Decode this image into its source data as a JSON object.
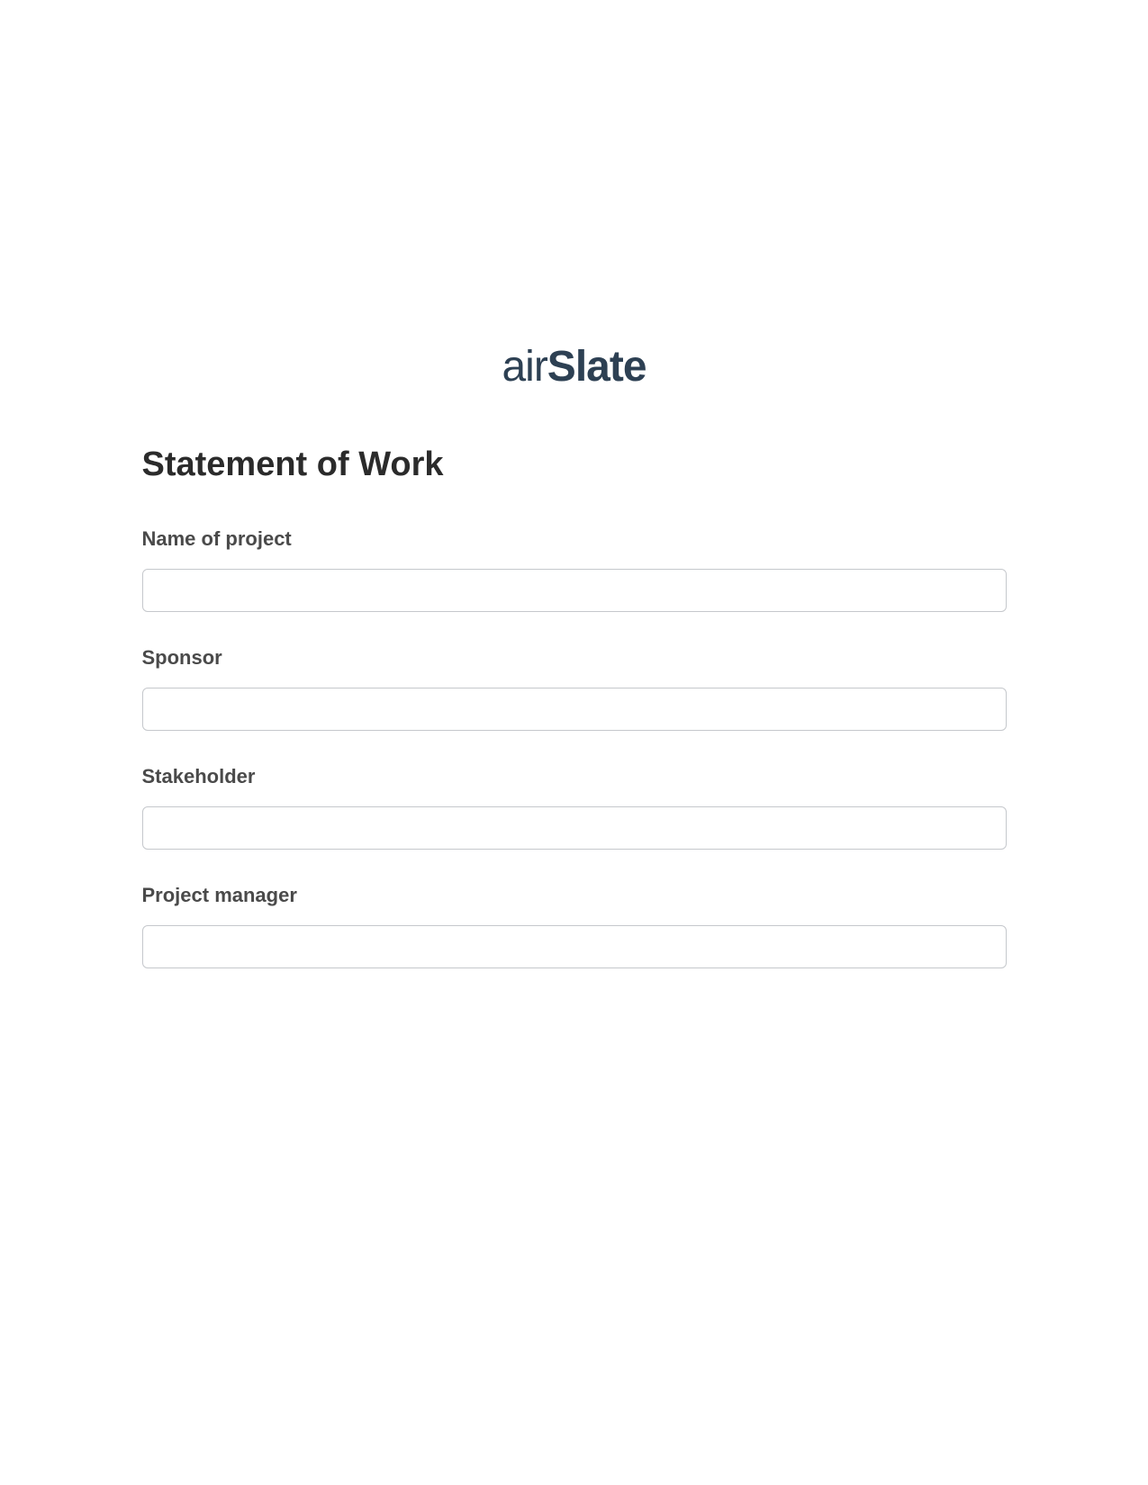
{
  "logo": {
    "prefix": "air",
    "suffix": "Slate"
  },
  "title": "Statement of Work",
  "fields": [
    {
      "label": "Name of project",
      "value": ""
    },
    {
      "label": "Sponsor",
      "value": ""
    },
    {
      "label": "Stakeholder",
      "value": ""
    },
    {
      "label": "Project manager",
      "value": ""
    }
  ]
}
